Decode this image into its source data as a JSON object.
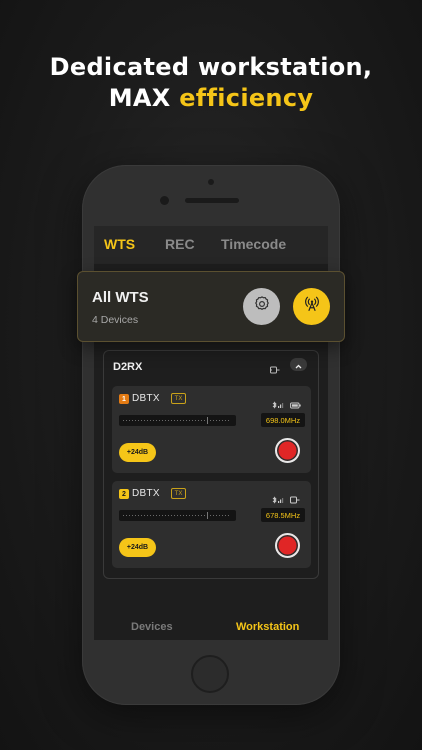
{
  "headline": {
    "line1": "Dedicated workstation,",
    "line2_prefix": "MAX",
    "line2_accent": "efficiency"
  },
  "tabs": [
    {
      "label": "WTS",
      "active": true
    },
    {
      "label": "REC",
      "active": false
    },
    {
      "label": "Timecode",
      "active": false
    }
  ],
  "all_wts": {
    "title": "All WTS",
    "subtitle": "4 Devices",
    "gear_icon": "gear-icon",
    "antenna_icon": "antenna-icon"
  },
  "receiver": {
    "name": "D2RX",
    "devices": [
      {
        "index": "1",
        "name": "DBTX",
        "mode": "TX",
        "frequency": "698.0MHz",
        "gain": "+24dB",
        "index_color": "#e37b14"
      },
      {
        "index": "2",
        "name": "DBTX",
        "mode": "TX",
        "frequency": "678.5MHz",
        "gain": "+24dB",
        "index_color": "#f5c518"
      }
    ]
  },
  "bottom_nav": [
    {
      "label": "Devices",
      "active": false
    },
    {
      "label": "Workstation",
      "active": true
    }
  ],
  "colors": {
    "accent": "#f5c518",
    "record": "#e02626",
    "background": "#1b1b1b"
  }
}
